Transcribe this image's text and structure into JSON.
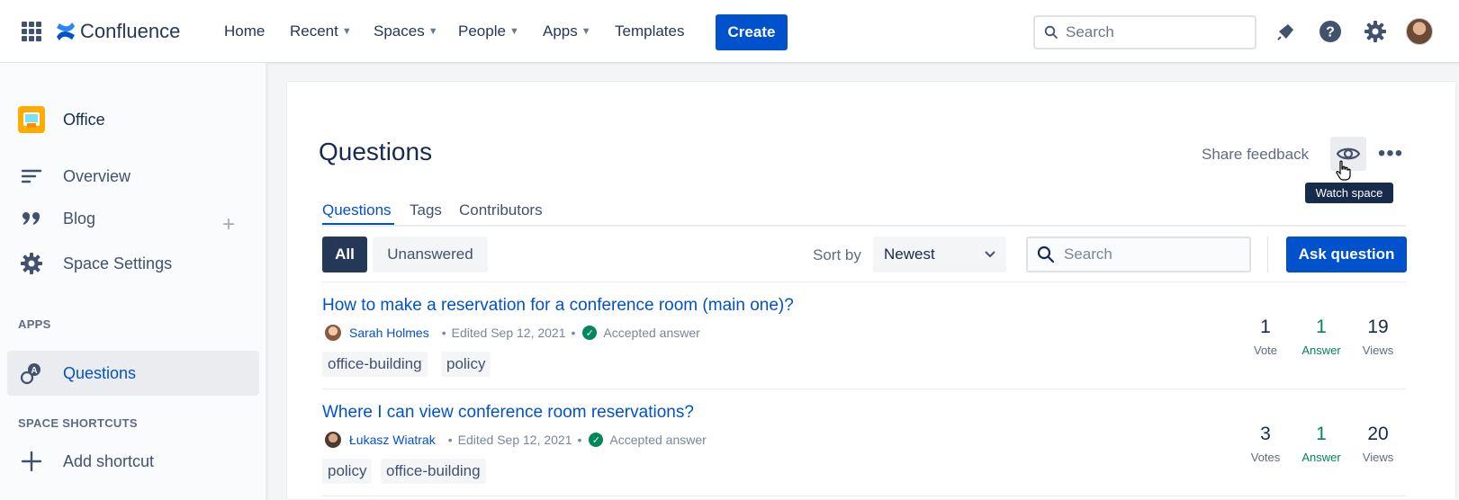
{
  "topnav": {
    "app_name": "Confluence",
    "items": [
      {
        "label": "Home",
        "has_chevron": false
      },
      {
        "label": "Recent",
        "has_chevron": true
      },
      {
        "label": "Spaces",
        "has_chevron": true
      },
      {
        "label": "People",
        "has_chevron": true
      },
      {
        "label": "Apps",
        "has_chevron": true
      },
      {
        "label": "Templates",
        "has_chevron": false
      }
    ],
    "create_label": "Create",
    "search_placeholder": "Search",
    "icons": [
      "apps-grid-icon",
      "notifications-icon",
      "help-icon",
      "settings-icon",
      "avatar"
    ]
  },
  "sidebar": {
    "space_name": "Office",
    "items": [
      {
        "label": "Overview",
        "icon": "overview-icon"
      },
      {
        "label": "Blog",
        "icon": "quote-icon"
      },
      {
        "label": "Space Settings",
        "icon": "gear-icon"
      }
    ],
    "apps_heading": "APPS",
    "apps": [
      {
        "label": "Questions",
        "icon": "questions-icon",
        "active": true
      }
    ],
    "shortcuts_heading": "SPACE SHORTCUTS",
    "add_shortcut_label": "Add shortcut"
  },
  "page": {
    "title": "Questions",
    "share_feedback": "Share feedback",
    "watch_tooltip": "Watch space",
    "tabs": [
      {
        "label": "Questions",
        "active": true
      },
      {
        "label": "Tags",
        "active": false
      },
      {
        "label": "Contributors",
        "active": false
      }
    ],
    "filters": {
      "all": "All",
      "unanswered": "Unanswered"
    },
    "sort": {
      "label": "Sort by",
      "value": "Newest"
    },
    "search_placeholder": "Search",
    "ask_button": "Ask question"
  },
  "questions": [
    {
      "title": "How to make a reservation for a conference room (main one)?",
      "author": "Sarah Holmes",
      "edited": "Edited Sep 12, 2021",
      "status": "Accepted answer",
      "tags": [
        "office-building",
        "policy"
      ],
      "votes": {
        "num": "1",
        "label": "Vote"
      },
      "answers": {
        "num": "1",
        "label": "Answer"
      },
      "views": {
        "num": "19",
        "label": "Views"
      }
    },
    {
      "title": "Where I can view conference room reservations?",
      "author": "Łukasz Wiatrak",
      "edited": "Edited Sep 12, 2021",
      "status": "Accepted answer",
      "tags": [
        "policy",
        "office-building"
      ],
      "votes": {
        "num": "3",
        "label": "Votes"
      },
      "answers": {
        "num": "1",
        "label": "Answer"
      },
      "views": {
        "num": "20",
        "label": "Views"
      }
    }
  ],
  "colors": {
    "accent": "#0052cc",
    "success": "#00875a",
    "dark": "#253858"
  }
}
